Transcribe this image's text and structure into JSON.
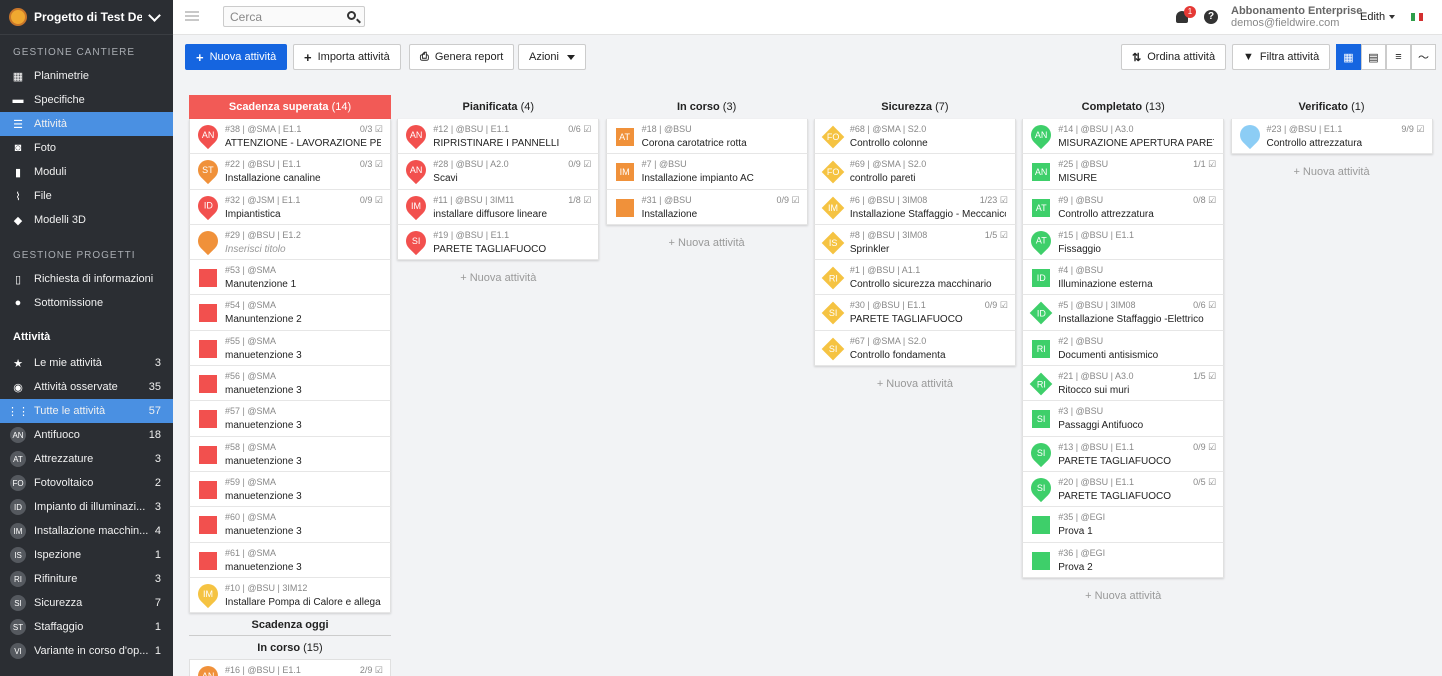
{
  "project": {
    "name": "Progetto di Test De..."
  },
  "sidebar": {
    "section1": "GESTIONE CANTIERE",
    "items1": [
      {
        "label": "Planimetrie",
        "icon": "map-icon"
      },
      {
        "label": "Specifiche",
        "icon": "book-icon"
      },
      {
        "label": "Attività",
        "icon": "list-icon"
      },
      {
        "label": "Foto",
        "icon": "camera-icon"
      },
      {
        "label": "Moduli",
        "icon": "clipboard-icon"
      },
      {
        "label": "File",
        "icon": "paperclip-icon"
      },
      {
        "label": "Modelli 3D",
        "icon": "cube-icon"
      }
    ],
    "section2": "GESTIONE PROGETTI",
    "items2": [
      {
        "label": "Richiesta di informazioni",
        "icon": "file-icon"
      },
      {
        "label": "Sottomissione",
        "icon": "user-icon"
      }
    ],
    "section3": "Attività",
    "items3": [
      {
        "label": "Le mie attività",
        "count": "3",
        "icon": "star-icon"
      },
      {
        "label": "Attività osservate",
        "count": "35",
        "icon": "eye-icon"
      },
      {
        "label": "Tutte le attività",
        "count": "57",
        "icon": "grid-icon"
      }
    ],
    "categories": [
      {
        "abbr": "AN",
        "label": "Antifuoco",
        "count": "18"
      },
      {
        "abbr": "AT",
        "label": "Attrezzature",
        "count": "3"
      },
      {
        "abbr": "FO",
        "label": "Fotovoltaico",
        "count": "2"
      },
      {
        "abbr": "ID",
        "label": "Impianto di illuminazi...",
        "count": "3"
      },
      {
        "abbr": "IM",
        "label": "Installazione macchin...",
        "count": "4"
      },
      {
        "abbr": "IS",
        "label": "Ispezione",
        "count": "1"
      },
      {
        "abbr": "RI",
        "label": "Rifiniture",
        "count": "3"
      },
      {
        "abbr": "SI",
        "label": "Sicurezza",
        "count": "7"
      },
      {
        "abbr": "ST",
        "label": "Staffaggio",
        "count": "1"
      },
      {
        "abbr": "VI",
        "label": "Variante in corso d'op...",
        "count": "1"
      }
    ]
  },
  "top": {
    "search_placeholder": "Cerca",
    "notif": "1",
    "help": "?",
    "sub_line1": "Abbonamento Enterprise",
    "sub_line2": "demos@fieldwire.com",
    "user": "Edith"
  },
  "toolbar": {
    "new": "Nuova attività",
    "import": "Importa attività",
    "report": "Genera report",
    "actions": "Azioni",
    "sort": "Ordina attività",
    "filter": "Filtra attività"
  },
  "board": {
    "new_label": "+ Nuova attività",
    "columns": [
      {
        "title": "Scadenza superata",
        "count": "(14)",
        "red": true,
        "cards": [
          {
            "meta": "#38 | @SMA | E1.1",
            "title": "ATTENZIONE - LAVORAZIONE PE...",
            "check": "0/3",
            "shape": "pin",
            "color": "#f2504e",
            "abbr": "AN"
          },
          {
            "meta": "#22 | @BSU | E1.1",
            "title": "Installazione canaline",
            "check": "0/3",
            "shape": "pin",
            "color": "#f0913a",
            "abbr": "ST"
          },
          {
            "meta": "#32 | @JSM | E1.1",
            "title": "Impiantistica",
            "check": "0/9",
            "shape": "pin",
            "color": "#f2504e",
            "abbr": "ID"
          },
          {
            "meta": "#29 | @BSU | E1.2",
            "title": "Inserisci titolo",
            "check": "",
            "shape": "pin",
            "color": "#f0913a",
            "abbr": "",
            "ph": true
          },
          {
            "meta": "#53 | @SMA",
            "title": "Manutenzione 1",
            "check": "",
            "shape": "sq",
            "color": "#f2504e",
            "abbr": ""
          },
          {
            "meta": "#54 | @SMA",
            "title": "Manuntenzione 2",
            "check": "",
            "shape": "sq",
            "color": "#f2504e",
            "abbr": ""
          },
          {
            "meta": "#55 | @SMA",
            "title": "manuetenzione 3",
            "check": "",
            "shape": "sq",
            "color": "#f2504e",
            "abbr": ""
          },
          {
            "meta": "#56 | @SMA",
            "title": "manuetenzione 3",
            "check": "",
            "shape": "sq",
            "color": "#f2504e",
            "abbr": ""
          },
          {
            "meta": "#57 | @SMA",
            "title": "manuetenzione 3",
            "check": "",
            "shape": "sq",
            "color": "#f2504e",
            "abbr": ""
          },
          {
            "meta": "#58 | @SMA",
            "title": "manuetenzione 3",
            "check": "",
            "shape": "sq",
            "color": "#f2504e",
            "abbr": ""
          },
          {
            "meta": "#59 | @SMA",
            "title": "manuetenzione 3",
            "check": "",
            "shape": "sq",
            "color": "#f2504e",
            "abbr": ""
          },
          {
            "meta": "#60 | @SMA",
            "title": "manuetenzione 3",
            "check": "",
            "shape": "sq",
            "color": "#f2504e",
            "abbr": ""
          },
          {
            "meta": "#61 | @SMA",
            "title": "manuetenzione 3",
            "check": "",
            "shape": "sq",
            "color": "#f2504e",
            "abbr": ""
          },
          {
            "meta": "#10 | @BSU | 3IM12",
            "title": "Installare Pompa di Calore e allegar...",
            "check": "",
            "shape": "pin",
            "color": "#f5c342",
            "abbr": "IM"
          }
        ],
        "groups": [
          {
            "title": "Scadenza oggi"
          },
          {
            "title": "In corso",
            "count": "(15)"
          }
        ],
        "tail": {
          "meta": "#16 | @BSU | E1.1",
          "check": "2/9",
          "color": "#f0913a",
          "abbr": "AN"
        }
      },
      {
        "title": "Pianificata",
        "count": "(4)",
        "cards": [
          {
            "meta": "#12 | @BSU | E1.1",
            "title": "RIPRISTINARE I PANNELLI",
            "check": "0/6",
            "shape": "pin",
            "color": "#f2504e",
            "abbr": "AN"
          },
          {
            "meta": "#28 | @BSU | A2.0",
            "title": "Scavi",
            "check": "0/9",
            "shape": "pin",
            "color": "#f2504e",
            "abbr": "AN"
          },
          {
            "meta": "#11 | @BSU | 3IM11",
            "title": "installare diffusore lineare",
            "check": "1/8",
            "shape": "pin",
            "color": "#f2504e",
            "abbr": "IM"
          },
          {
            "meta": "#19 | @BSU | E1.1",
            "title": "PARETE TAGLIAFUOCO",
            "check": "",
            "shape": "pin",
            "color": "#f2504e",
            "abbr": "SI"
          }
        ]
      },
      {
        "title": "In corso",
        "count": "(3)",
        "cards": [
          {
            "meta": "#18 | @BSU",
            "title": "Corona carotatrice rotta",
            "check": "",
            "shape": "sq",
            "color": "#f0913a",
            "abbr": "AT"
          },
          {
            "meta": "#7 | @BSU",
            "title": "Installazione impianto AC",
            "check": "",
            "shape": "sq",
            "color": "#f0913a",
            "abbr": "IM"
          },
          {
            "meta": "#31 | @BSU",
            "title": "Installazione",
            "check": "0/9",
            "shape": "sq",
            "color": "#f0913a",
            "abbr": ""
          }
        ]
      },
      {
        "title": "Sicurezza",
        "count": "(7)",
        "cards": [
          {
            "meta": "#68 | @SMA | S2.0",
            "title": "Controllo colonne",
            "check": "",
            "shape": "dia",
            "color": "#f5c342",
            "abbr": "FO"
          },
          {
            "meta": "#69 | @SMA | S2.0",
            "title": "controllo pareti",
            "check": "",
            "shape": "dia",
            "color": "#f5c342",
            "abbr": "FO"
          },
          {
            "meta": "#6 | @BSU | 3IM08",
            "title": "Installazione Staffaggio - Meccanico",
            "check": "1/23",
            "shape": "dia",
            "color": "#f5c342",
            "abbr": "IM"
          },
          {
            "meta": "#8 | @BSU | 3IM08",
            "title": "Sprinkler",
            "check": "1/5",
            "shape": "dia",
            "color": "#f5c342",
            "abbr": "IS"
          },
          {
            "meta": "#1 | @BSU | A1.1",
            "title": "Controllo sicurezza macchinario",
            "check": "",
            "shape": "dia",
            "color": "#f5c342",
            "abbr": "RI"
          },
          {
            "meta": "#30 | @BSU | E1.1",
            "title": "PARETE TAGLIAFUOCO",
            "check": "0/9",
            "shape": "dia",
            "color": "#f5c342",
            "abbr": "SI"
          },
          {
            "meta": "#67 | @SMA | S2.0",
            "title": "Controllo fondamenta",
            "check": "",
            "shape": "dia",
            "color": "#f5c342",
            "abbr": "SI"
          }
        ]
      },
      {
        "title": "Completato",
        "count": "(13)",
        "cards": [
          {
            "meta": "#14 | @BSU | A3.0",
            "title": "MISURAZIONE APERTURA PARETE",
            "check": "",
            "shape": "pin",
            "color": "#3ecf6a",
            "abbr": "AN"
          },
          {
            "meta": "#25 | @BSU",
            "title": "MISURE",
            "check": "1/1",
            "shape": "sq",
            "color": "#3ecf6a",
            "abbr": "AN"
          },
          {
            "meta": "#9 | @BSU",
            "title": "Controllo attrezzatura",
            "check": "0/8",
            "shape": "sq",
            "color": "#3ecf6a",
            "abbr": "AT"
          },
          {
            "meta": "#15 | @BSU | E1.1",
            "title": "Fissaggio",
            "check": "",
            "shape": "pin",
            "color": "#3ecf6a",
            "abbr": "AT"
          },
          {
            "meta": "#4 | @BSU",
            "title": "Illuminazione esterna",
            "check": "",
            "shape": "sq",
            "color": "#3ecf6a",
            "abbr": "ID"
          },
          {
            "meta": "#5 | @BSU | 3IM08",
            "title": "Installazione Staffaggio -Elettrico",
            "check": "0/6",
            "shape": "dia",
            "color": "#3ecf6a",
            "abbr": "ID"
          },
          {
            "meta": "#2 | @BSU",
            "title": "Documenti antisismico",
            "check": "",
            "shape": "sq",
            "color": "#3ecf6a",
            "abbr": "RI"
          },
          {
            "meta": "#21 | @BSU | A3.0",
            "title": "Ritocco sui muri",
            "check": "1/5",
            "shape": "dia",
            "color": "#3ecf6a",
            "abbr": "RI"
          },
          {
            "meta": "#3 | @BSU",
            "title": "Passaggi Antifuoco",
            "check": "",
            "shape": "sq",
            "color": "#3ecf6a",
            "abbr": "SI"
          },
          {
            "meta": "#13 | @BSU | E1.1",
            "title": "PARETE TAGLIAFUOCO",
            "check": "0/9",
            "shape": "pin",
            "color": "#3ecf6a",
            "abbr": "SI"
          },
          {
            "meta": "#20 | @BSU | E1.1",
            "title": "PARETE TAGLIAFUOCO",
            "check": "0/5",
            "shape": "pin",
            "color": "#3ecf6a",
            "abbr": "SI"
          },
          {
            "meta": "#35 | @EGI",
            "title": "Prova 1",
            "check": "",
            "shape": "sq",
            "color": "#3ecf6a",
            "abbr": ""
          },
          {
            "meta": "#36 | @EGI",
            "title": "Prova 2",
            "check": "",
            "shape": "sq",
            "color": "#3ecf6a",
            "abbr": ""
          }
        ]
      },
      {
        "title": "Verificato",
        "count": "(1)",
        "cards": [
          {
            "meta": "#23 | @BSU | E1.1",
            "title": "Controllo attrezzatura",
            "check": "9/9",
            "shape": "pin",
            "color": "#8ccdf5",
            "abbr": ""
          }
        ]
      }
    ]
  }
}
